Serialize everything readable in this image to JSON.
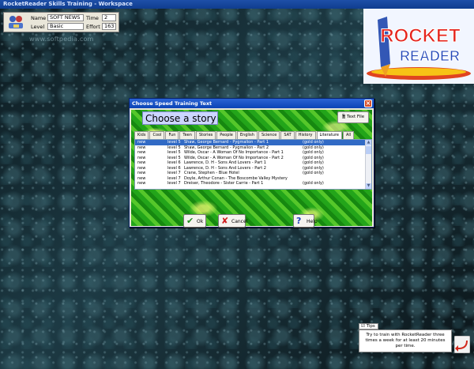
{
  "window": {
    "title": "RocketReader Skills Training - Workspace"
  },
  "info": {
    "name_label": "Name",
    "name_value": "SOFT NEWS",
    "level_label": "Level",
    "level_value": "Basic",
    "time_label": "Time",
    "time_value": "2",
    "effort_label": "Effort",
    "effort_value": "163"
  },
  "watermark": "www.softpedia.com",
  "logo": {
    "line1": "ROCKET",
    "line2": "READER"
  },
  "dialog": {
    "title": "Choose Speed Training Text",
    "heading": "Choose a story",
    "text_file_label": "Text File",
    "tabs": [
      "Kids",
      "Cool",
      "Fun",
      "Teen",
      "Stories",
      "People",
      "English",
      "Science",
      "SAT",
      "History",
      "Literature",
      "All"
    ],
    "active_tab": "Literature",
    "rows": [
      {
        "status": "new",
        "level": "level 5",
        "title": "Shaw, George Bernard - Pygmalion - Part 1",
        "note": "(gold only)"
      },
      {
        "status": "new",
        "level": "level 5",
        "title": "Shaw, George Bernard - Pygmalion - Part 2",
        "note": "(gold only)"
      },
      {
        "status": "new",
        "level": "level 5",
        "title": "Wilde, Oscar - A Woman Of No Importance - Part 1",
        "note": "(gold only)"
      },
      {
        "status": "new",
        "level": "level 5",
        "title": "Wilde, Oscar - A Woman Of No Importance - Part 2",
        "note": "(gold only)"
      },
      {
        "status": "new",
        "level": "level 6",
        "title": "Lawrence, D. H - Sons And Lovers - Part 1",
        "note": "(gold only)"
      },
      {
        "status": "new",
        "level": "level 6",
        "title": "Lawrence, D. H - Sons And Lovers - Part 2",
        "note": "(gold only)"
      },
      {
        "status": "new",
        "level": "level 7",
        "title": "Crane, Stephen - Blue Hotel",
        "note": "(gold only)"
      },
      {
        "status": "new",
        "level": "level 7",
        "title": "Doyle, Arthur Conan - The Boscombe Valley Mystery",
        "note": ""
      },
      {
        "status": "new",
        "level": "level 7",
        "title": "Dreiser, Theodore - Sister Carrie - Part 1",
        "note": "(gold only)"
      }
    ],
    "ok_label": "Ok",
    "cancel_label": "Cancel",
    "help_label": "Help"
  },
  "tips": {
    "tab_label": "Tips",
    "text": "Try to train with RocketReader three times a week for at least 20 minutes per time."
  },
  "colors": {
    "selection": "#316ac5",
    "titlebar": "#0b44b5",
    "accent": "#d9522c"
  }
}
